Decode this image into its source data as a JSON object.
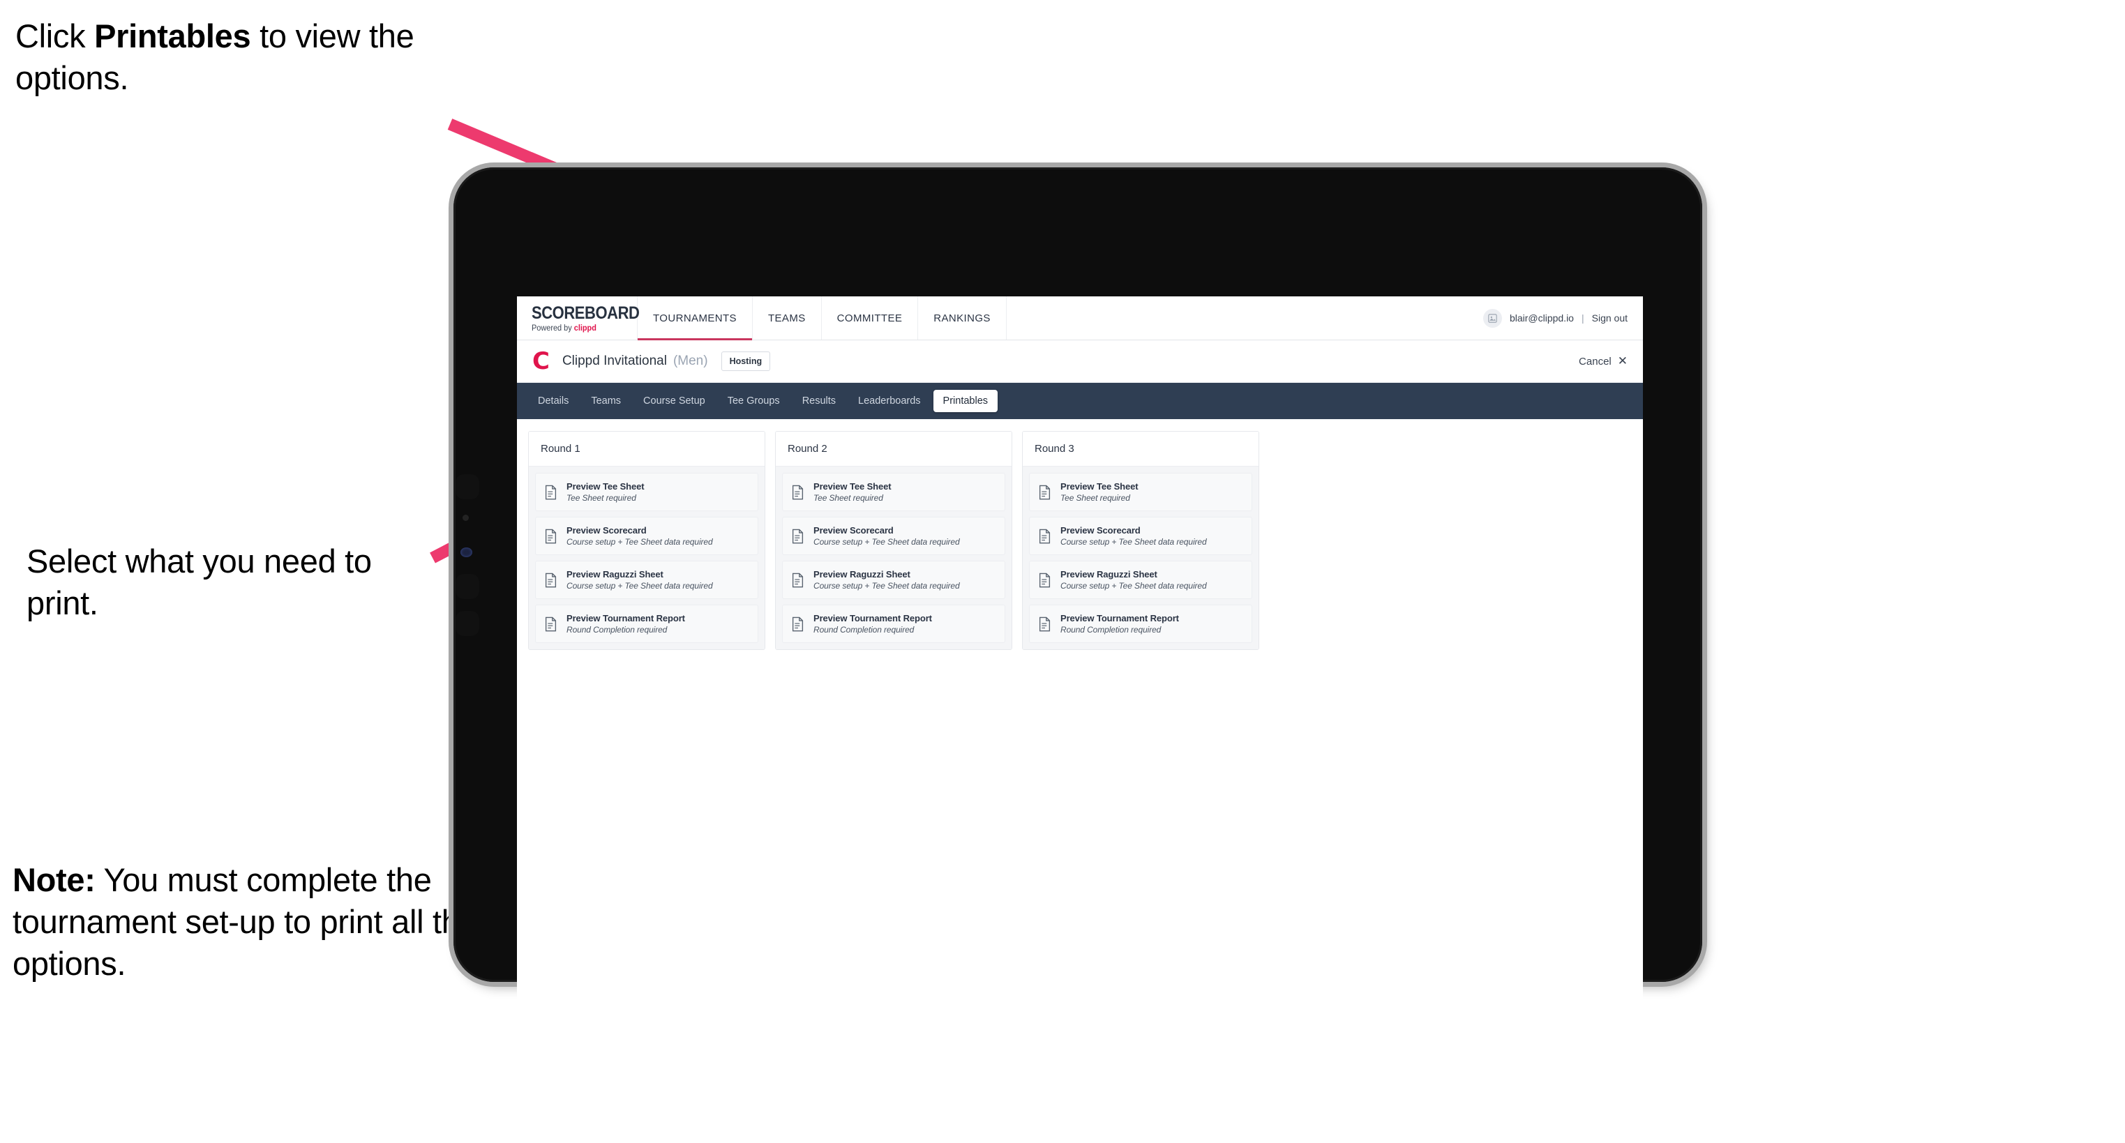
{
  "annotations": {
    "top": {
      "prefix": "Click ",
      "bold": "Printables",
      "suffix": " to view the options."
    },
    "middle": "Select what you need to print.",
    "note": {
      "bold": "Note:",
      "text": " You must complete the tournament set-up to print all the options."
    }
  },
  "colors": {
    "arrow_pink": "#ED3A6E",
    "nav_active_underline": "#C9365E",
    "tabstrip_navy": "#2F3E53",
    "brand_red": "#E0144C",
    "tablet_body": "#0D0D0D",
    "tablet_edge": "#A8A8A8"
  },
  "app": {
    "logo": {
      "word": "SCOREBOARD",
      "powered_by": "Powered by ",
      "brand": "clippd"
    },
    "topnav": {
      "items": [
        {
          "label": "TOURNAMENTS",
          "active": true
        },
        {
          "label": "TEAMS",
          "active": false
        },
        {
          "label": "COMMITTEE",
          "active": false
        },
        {
          "label": "RANKINGS",
          "active": false
        }
      ],
      "user": {
        "avatar_icon": "user-avatar-icon",
        "email": "blair@clippd.io",
        "separator": "|",
        "signout": "Sign out"
      }
    },
    "tournament_bar": {
      "brand_mark": "C",
      "title": "Clippd Invitational",
      "gender": "(Men)",
      "status_badge": "Hosting",
      "cancel_label": "Cancel",
      "cancel_icon": "close-icon"
    },
    "tabs": [
      {
        "label": "Details",
        "active": false
      },
      {
        "label": "Teams",
        "active": false
      },
      {
        "label": "Course Setup",
        "active": false
      },
      {
        "label": "Tee Groups",
        "active": false
      },
      {
        "label": "Results",
        "active": false
      },
      {
        "label": "Leaderboards",
        "active": false
      },
      {
        "label": "Printables",
        "active": true
      }
    ],
    "rounds": [
      {
        "title": "Round 1",
        "items": [
          {
            "title": "Preview Tee Sheet",
            "sub": "Tee Sheet required"
          },
          {
            "title": "Preview Scorecard",
            "sub": "Course setup + Tee Sheet data required"
          },
          {
            "title": "Preview Raguzzi Sheet",
            "sub": "Course setup + Tee Sheet data required"
          },
          {
            "title": "Preview Tournament Report",
            "sub": "Round Completion required"
          }
        ]
      },
      {
        "title": "Round 2",
        "items": [
          {
            "title": "Preview Tee Sheet",
            "sub": "Tee Sheet required"
          },
          {
            "title": "Preview Scorecard",
            "sub": "Course setup + Tee Sheet data required"
          },
          {
            "title": "Preview Raguzzi Sheet",
            "sub": "Course setup + Tee Sheet data required"
          },
          {
            "title": "Preview Tournament Report",
            "sub": "Round Completion required"
          }
        ]
      },
      {
        "title": "Round 3",
        "items": [
          {
            "title": "Preview Tee Sheet",
            "sub": "Tee Sheet required"
          },
          {
            "title": "Preview Scorecard",
            "sub": "Course setup + Tee Sheet data required"
          },
          {
            "title": "Preview Raguzzi Sheet",
            "sub": "Course setup + Tee Sheet data required"
          },
          {
            "title": "Preview Tournament Report",
            "sub": "Round Completion required"
          }
        ]
      }
    ]
  }
}
